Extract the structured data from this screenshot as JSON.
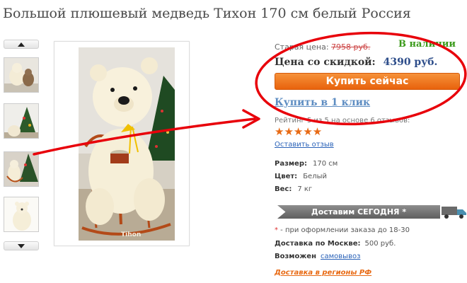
{
  "product": {
    "title": "Большой плюшевый медведь Тихон 170 см белый Россия"
  },
  "gallery": {
    "up_icon": "chevron-up-icon",
    "down_icon": "chevron-down-icon",
    "thumbnails": [
      "thumbnail-1",
      "thumbnail-2",
      "thumbnail-3",
      "thumbnail-4"
    ],
    "watermark": "Tihon"
  },
  "pricing": {
    "old_price_label": "Старая цена:",
    "old_price": "7958 руб.",
    "availability": "В наличии",
    "discount_label": "Цена со скидкой:",
    "discount_price": "4390 руб.",
    "buy_now": "Купить сейчас",
    "one_click": "Купить в 1 клик"
  },
  "rating": {
    "text": "Рейтинг 5 из 5 на основе 6 отзывов:",
    "stars": "★★★★★",
    "value": 5,
    "max": 5,
    "leave_review": "Оставить отзыв"
  },
  "specs": [
    {
      "label": "Размер:",
      "value": "170 см"
    },
    {
      "label": "Цвет:",
      "value": "Белый"
    },
    {
      "label": "Вес:",
      "value": "7 кг"
    }
  ],
  "delivery": {
    "banner": "Доставим СЕГОДНЯ *",
    "truck_icon": "truck-icon",
    "note_star": "*",
    "note": " - при оформлении заказа до 18-30",
    "moscow_label": "Доставка по Москве:",
    "moscow_value": "500 руб.",
    "pickup_label": "Возможен",
    "pickup_link": "самовывоз",
    "regions_link": "Доставка в регионы РФ"
  },
  "colors": {
    "accent_orange": "#e8620c",
    "link_blue": "#2a62b8",
    "instock_green": "#3a9a1a",
    "annotation_red": "#e8000a"
  }
}
